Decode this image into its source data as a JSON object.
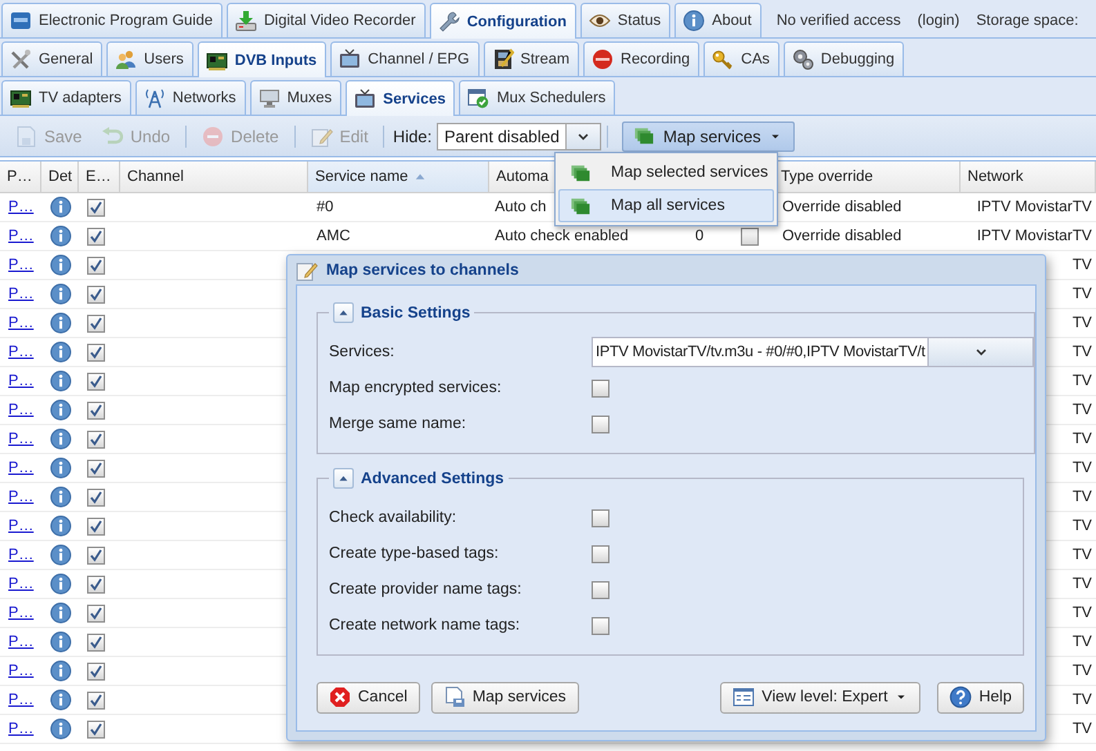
{
  "top_tabs": [
    {
      "label": "Electronic Program Guide",
      "selected": false
    },
    {
      "label": "Digital Video Recorder",
      "selected": false
    },
    {
      "label": "Configuration",
      "selected": true
    },
    {
      "label": "Status",
      "selected": false
    },
    {
      "label": "About",
      "selected": false
    }
  ],
  "session": {
    "access": "No verified access",
    "login": "(login)",
    "storage": "Storage space:"
  },
  "config_tabs": [
    {
      "label": "General",
      "selected": false
    },
    {
      "label": "Users",
      "selected": false
    },
    {
      "label": "DVB Inputs",
      "selected": true
    },
    {
      "label": "Channel / EPG",
      "selected": false
    },
    {
      "label": "Stream",
      "selected": false
    },
    {
      "label": "Recording",
      "selected": false
    },
    {
      "label": "CAs",
      "selected": false
    },
    {
      "label": "Debugging",
      "selected": false
    }
  ],
  "input_tabs": [
    {
      "label": "TV adapters",
      "selected": false
    },
    {
      "label": "Networks",
      "selected": false
    },
    {
      "label": "Muxes",
      "selected": false
    },
    {
      "label": "Services",
      "selected": true
    },
    {
      "label": "Mux Schedulers",
      "selected": false
    }
  ],
  "toolbar": {
    "buttons": [
      {
        "label": "Save",
        "disabled": true
      },
      {
        "label": "Undo",
        "disabled": true
      },
      {
        "label": "Delete",
        "disabled": true
      },
      {
        "label": "Edit",
        "disabled": true
      }
    ],
    "hide_label": "Hide:",
    "hide_value": "Parent disabled",
    "map_button": {
      "label": "Map services",
      "pressed": true
    }
  },
  "grid": {
    "columns": [
      {
        "label": "P…",
        "sorted": false
      },
      {
        "label": "Det",
        "sorted": false
      },
      {
        "label": "E…",
        "sorted": false
      },
      {
        "label": "Channel",
        "sorted": false
      },
      {
        "label": "Service name",
        "sorted": true
      },
      {
        "label": "Automa",
        "sorted": false
      },
      {
        "label": "Type override",
        "sorted": false
      },
      {
        "label": "Network",
        "sorted": false
      }
    ],
    "rows": [
      {
        "link": "P…",
        "enabled": true,
        "service": "#0",
        "auto": "Auto ch",
        "override": "Override disabled",
        "network": "IPTV MovistarTV"
      },
      {
        "link": "P…",
        "enabled": true,
        "service": "AMC",
        "auto": "Auto check enabled",
        "count": "0",
        "mapped": false,
        "override": "Override disabled",
        "network": "IPTV MovistarTV"
      },
      {
        "link": "P…",
        "enabled": true,
        "network": "TV"
      },
      {
        "link": "P…",
        "enabled": true,
        "network": "TV"
      },
      {
        "link": "P…",
        "enabled": true,
        "network": "TV"
      },
      {
        "link": "P…",
        "enabled": true,
        "network": "TV"
      },
      {
        "link": "P…",
        "enabled": true,
        "network": "TV"
      },
      {
        "link": "P…",
        "enabled": true,
        "network": "TV"
      },
      {
        "link": "P…",
        "enabled": true,
        "network": "TV"
      },
      {
        "link": "P…",
        "enabled": true,
        "network": "TV"
      },
      {
        "link": "P…",
        "enabled": true,
        "network": "TV"
      },
      {
        "link": "P…",
        "enabled": true,
        "network": "TV"
      },
      {
        "link": "P…",
        "enabled": true,
        "network": "TV"
      },
      {
        "link": "P…",
        "enabled": true,
        "network": "TV"
      },
      {
        "link": "P…",
        "enabled": true,
        "network": "TV"
      },
      {
        "link": "P…",
        "enabled": true,
        "network": "TV"
      },
      {
        "link": "P…",
        "enabled": true,
        "network": "TV"
      },
      {
        "link": "P…",
        "enabled": true,
        "network": "TV"
      },
      {
        "link": "P…",
        "enabled": true,
        "network": "TV"
      }
    ]
  },
  "menu": {
    "items": [
      {
        "label": "Map selected services",
        "selected": false
      },
      {
        "label": "Map all services",
        "selected": true
      }
    ]
  },
  "dialog": {
    "title": "Map services to channels",
    "fieldsets": [
      {
        "title": "Basic Settings",
        "expanded": true,
        "fields": [
          {
            "kind": "combo",
            "label": "Services:",
            "value": "IPTV MovistarTV/tv.m3u - #0/#0,IPTV MovistarTV/t"
          },
          {
            "kind": "checkbox",
            "label": "Map encrypted services:",
            "checked": false
          },
          {
            "kind": "checkbox",
            "label": "Merge same name:",
            "checked": false
          }
        ]
      },
      {
        "title": "Advanced Settings",
        "expanded": true,
        "fields": [
          {
            "kind": "checkbox",
            "label": "Check availability:",
            "checked": false
          },
          {
            "kind": "checkbox",
            "label": "Create type-based tags:",
            "checked": false
          },
          {
            "kind": "checkbox",
            "label": "Create provider name tags:",
            "checked": false
          },
          {
            "kind": "checkbox",
            "label": "Create network name tags:",
            "checked": false
          }
        ]
      }
    ],
    "buttons": [
      {
        "kind": "cancel",
        "label": "Cancel"
      },
      {
        "kind": "map",
        "label": "Map services"
      },
      {
        "kind": "viewlevel",
        "label": "View level: Expert"
      },
      {
        "kind": "help",
        "label": "Help"
      }
    ]
  }
}
